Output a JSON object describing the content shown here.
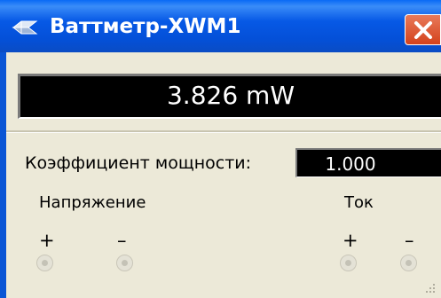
{
  "window": {
    "title": "Ваттметр-XWM1",
    "icon": "wattmeter-icon",
    "close_icon": "close-icon"
  },
  "display": {
    "power_reading": "3.826 mW"
  },
  "power_factor": {
    "label": "Коэффициент мощности:",
    "value": "1.000"
  },
  "voltage": {
    "label": "Напряжение",
    "plus": "+",
    "minus": "–"
  },
  "current": {
    "label": "Ток",
    "plus": "+",
    "minus": "–"
  },
  "colors": {
    "titlebar": "#0450d8",
    "close_button": "#d4421c",
    "display_bg": "#000000",
    "display_text": "#ffffff",
    "window_bg": "#ece9d8"
  }
}
